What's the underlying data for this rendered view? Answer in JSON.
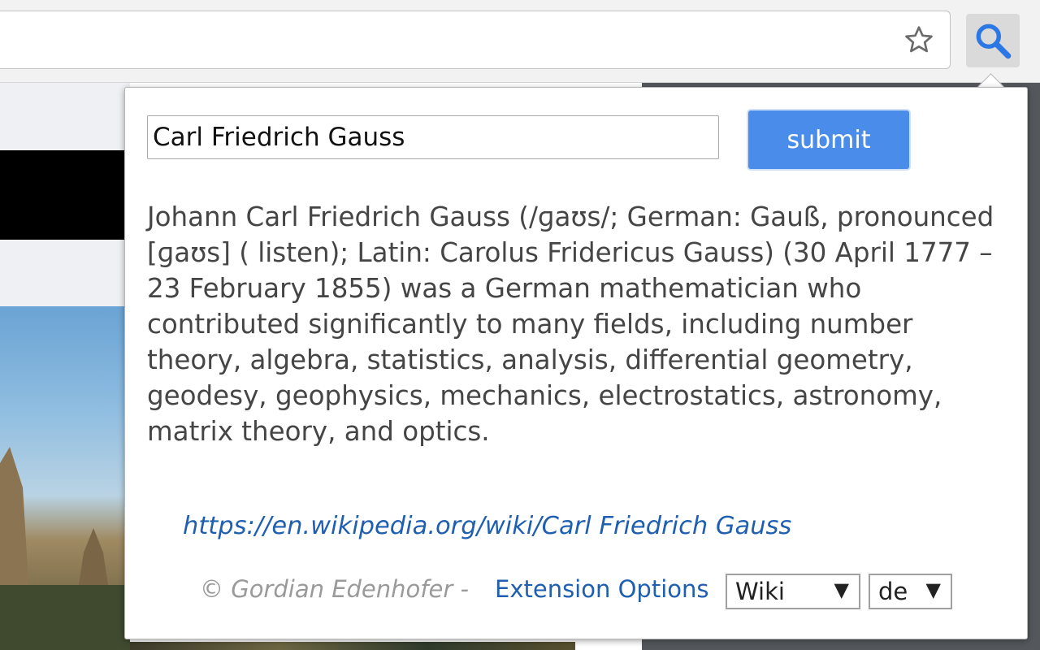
{
  "toolbar": {
    "bookmark_icon": "star-outline-icon",
    "extension_icon": "magnifier-icon",
    "accent_color": "#4a8cea"
  },
  "popup": {
    "search": {
      "value": "Carl Friedrich Gauss"
    },
    "submit_label": "submit",
    "summary": "Johann Carl Friedrich Gauss (/ɡaʊs/; German: Gauß, pronounced [ɡaʊs] ( listen); Latin: Carolus Fridericus Gauss) (30 April 1777 – 23 February 1855) was a German mathematician who contributed significantly to many fields, including number theory, algebra, statistics, analysis, differential geometry, geodesy, geophysics, mechanics, electrostatics, astronomy, matrix theory, and optics.",
    "link": "https://en.wikipedia.org/wiki/Carl Friedrich Gauss",
    "footer": {
      "copyright": "© Gordian Edenhofer - ",
      "options_label": "Extension Options",
      "source_select": "Wiki",
      "language_select": "de"
    }
  }
}
